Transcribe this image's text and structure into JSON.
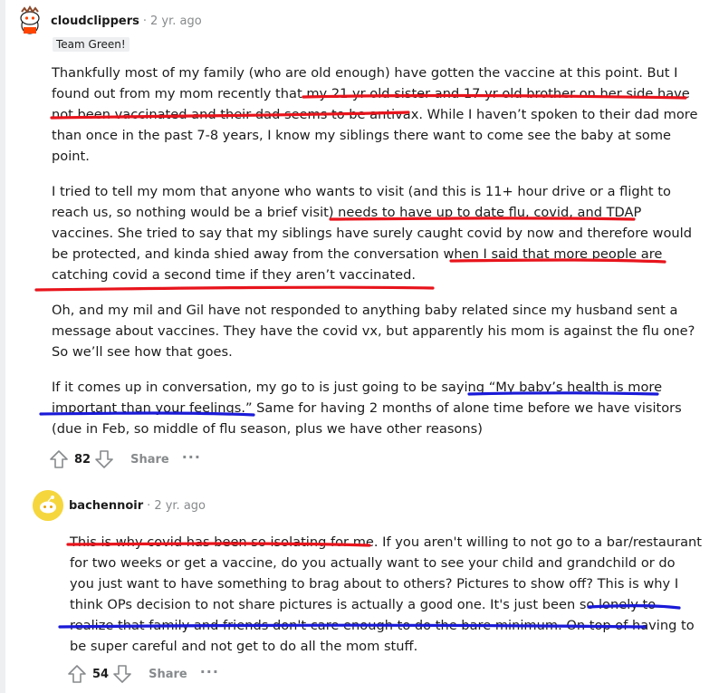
{
  "comments": [
    {
      "username": "cloudclippers",
      "separator": "·",
      "age": "2 yr. ago",
      "flair": "Team Green!",
      "paragraphs": [
        "Thankfully most of my family (who are old enough) have gotten the vaccine at this point. But I found out from my mom recently that my 21 yr old sister and 17 yr old brother on her side have not been vaccinated and their dad seems to be antivax. While I haven’t spoken to their dad more than once in the past 7-8 years, I know my siblings there want to come see the baby at some point.",
        "I tried to tell my mom that anyone who wants to visit (and this is 11+ hour drive or a flight to reach us, so nothing would be a brief visit) needs to have up to date flu, covid, and TDAP vaccines. She tried to say that my siblings have surely caught covid by now and therefore would be protected, and kinda shied away from the conversation when I said that more people are catching covid a second time if they aren’t vaccinated.",
        "Oh, and my mil and Gil have not responded to anything baby related since my husband sent a message about vaccines. They have the covid vx, but apparently his mom is against the flu one? So we’ll see how that goes.",
        "If it comes up in conversation, my go to is just going to be saying “My baby’s health is more important than your feelings.” Same for having 2 months of alone time before we have visitors (due in Feb, so middle of flu season, plus we have other reasons)"
      ],
      "score": "82",
      "share_label": "Share",
      "more_label": "···"
    },
    {
      "username": "bachennoir",
      "separator": "·",
      "age": "2 yr. ago",
      "paragraphs": [
        "This is why covid has been so isolating for me. If you aren't willing to not go to a bar/restaurant for two weeks or get a vaccine, do you actually want to see your child and grandchild or do you just want to have something to brag about to others? Pictures to show off? This is why I think OPs decision to not share pictures is actually a good one. It's just been so lonely to realize that family and friends don't care enough to do the bare minimum. On top of having to be super careful and not get to do all the mom stuff."
      ],
      "score": "54",
      "share_label": "Share",
      "more_label": "···"
    }
  ],
  "colors": {
    "text": "#1c1c1c",
    "meta": "#878a8c",
    "flair_bg": "#edeff1",
    "red_ink": "#e8141c",
    "blue_ink": "#1a1ad8"
  },
  "icons": [
    "snoo-avatar-icon",
    "snoo-avatar-yellow-icon",
    "upvote-arrow-icon",
    "downvote-arrow-icon",
    "more-options-icon"
  ]
}
